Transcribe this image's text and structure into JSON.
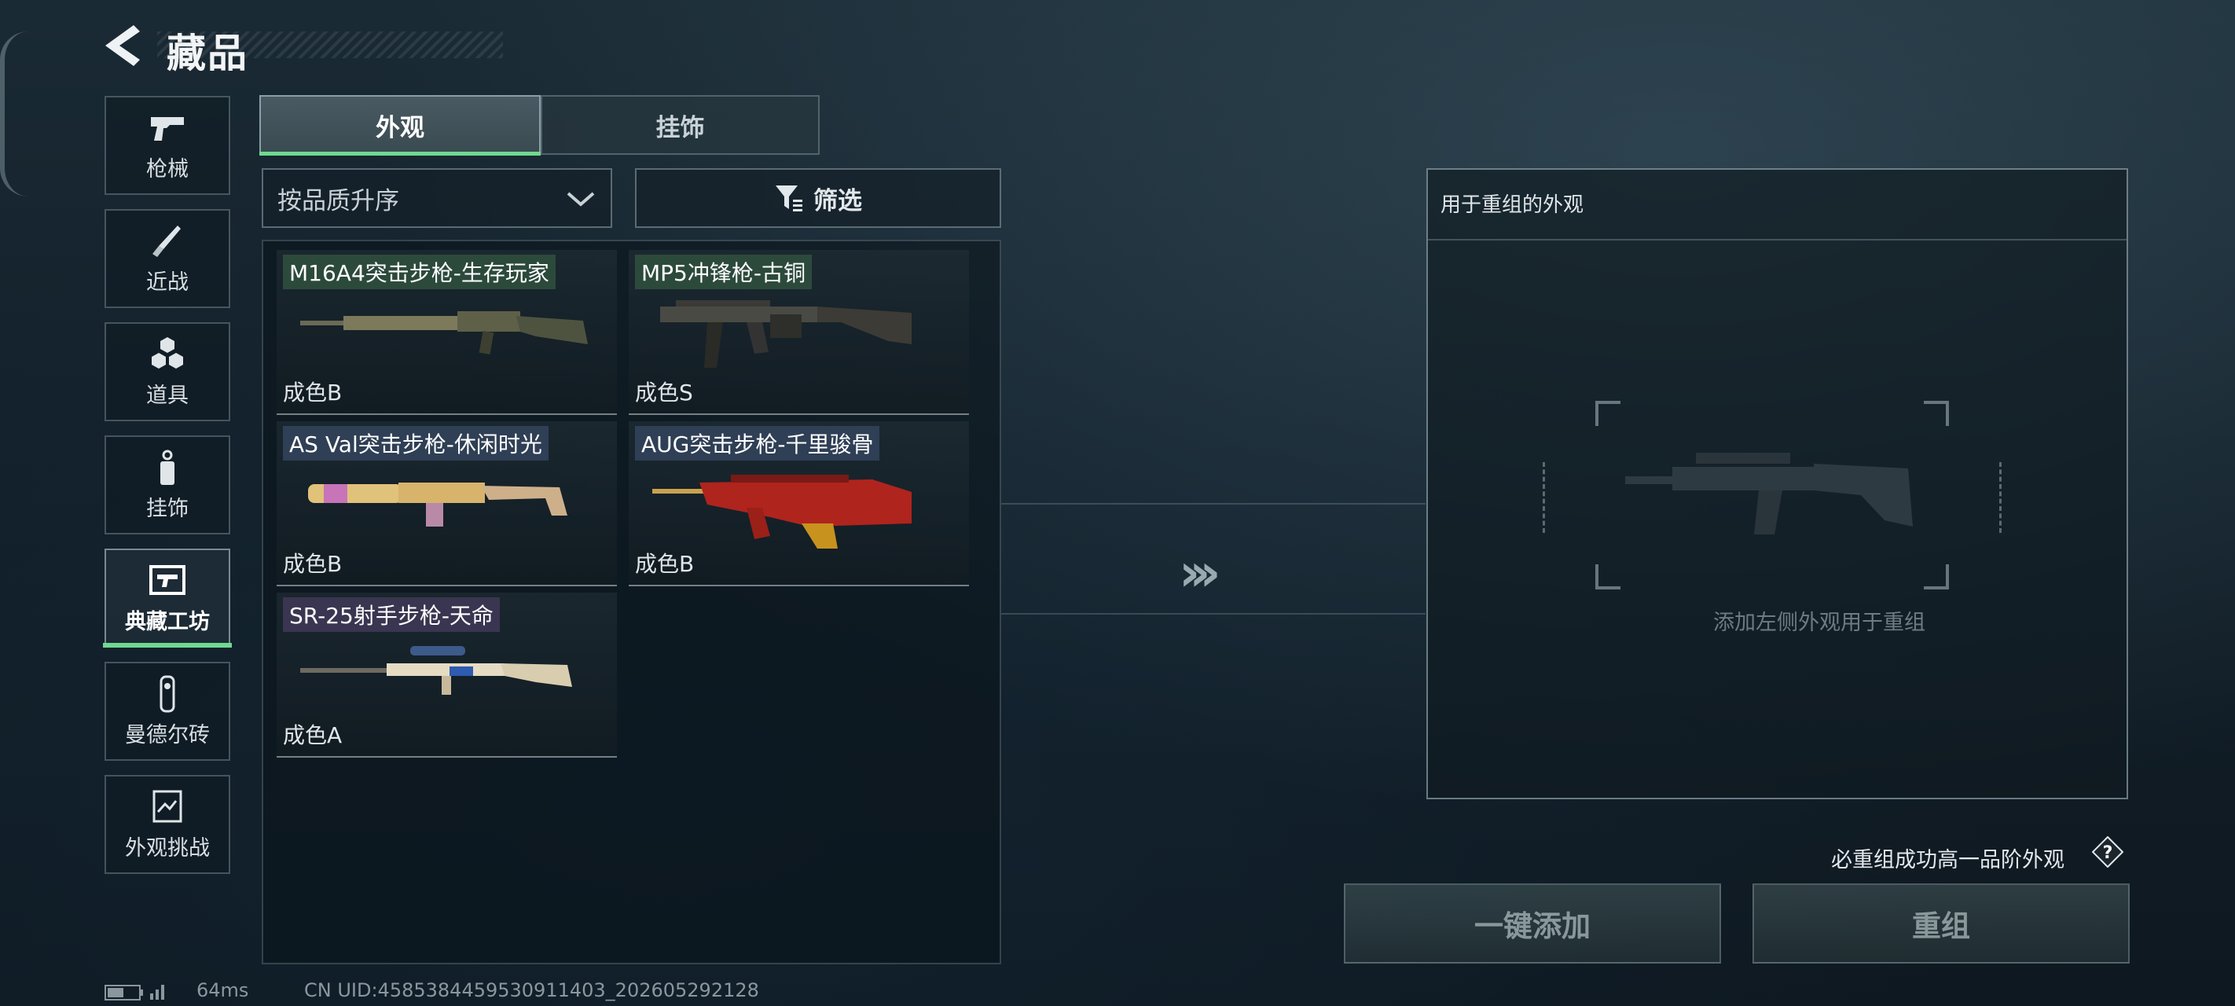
{
  "header": {
    "title": "藏品"
  },
  "nav": {
    "items": [
      {
        "label": "枪械",
        "icon": "pistol-icon"
      },
      {
        "label": "近战",
        "icon": "knife-icon"
      },
      {
        "label": "道具",
        "icon": "grenades-icon"
      },
      {
        "label": "挂饰",
        "icon": "charm-icon"
      },
      {
        "label": "典藏工坊",
        "icon": "workshop-icon",
        "active": true
      },
      {
        "label": "曼德尔砖",
        "icon": "brick-icon"
      },
      {
        "label": "外观挑战",
        "icon": "challenge-icon"
      }
    ],
    "active_color": "#6fd98f"
  },
  "tabs": [
    {
      "label": "外观",
      "active": true
    },
    {
      "label": "挂饰",
      "active": false
    }
  ],
  "sort": {
    "label": "按品质升序"
  },
  "filter": {
    "label": "筛选"
  },
  "items": [
    {
      "name": "M16A4突击步枪-生存玩家",
      "grade": "成色B",
      "name_bg": "#2c4a3c"
    },
    {
      "name": "MP5冲锋枪-古铜",
      "grade": "成色S",
      "name_bg": "#2c4a3c"
    },
    {
      "name": "AS Val突击步枪-休闲时光",
      "grade": "成色B",
      "name_bg": "#2f3f55"
    },
    {
      "name": "AUG突击步枪-千里骏骨",
      "grade": "成色B",
      "name_bg": "#2f3f55"
    },
    {
      "name": "SR-25射手步枪-天命",
      "grade": "成色A",
      "name_bg": "#3a3550"
    }
  ],
  "recombine": {
    "panel_title": "用于重组的外观",
    "hint": "添加左侧外观用于重组",
    "guarantee": "必重组成功高一品阶外观",
    "add_button": "一键添加",
    "recombine_button": "重组"
  },
  "status": {
    "ping": "64ms",
    "uid": "CN UID:4585384459530911403_202605292128"
  }
}
